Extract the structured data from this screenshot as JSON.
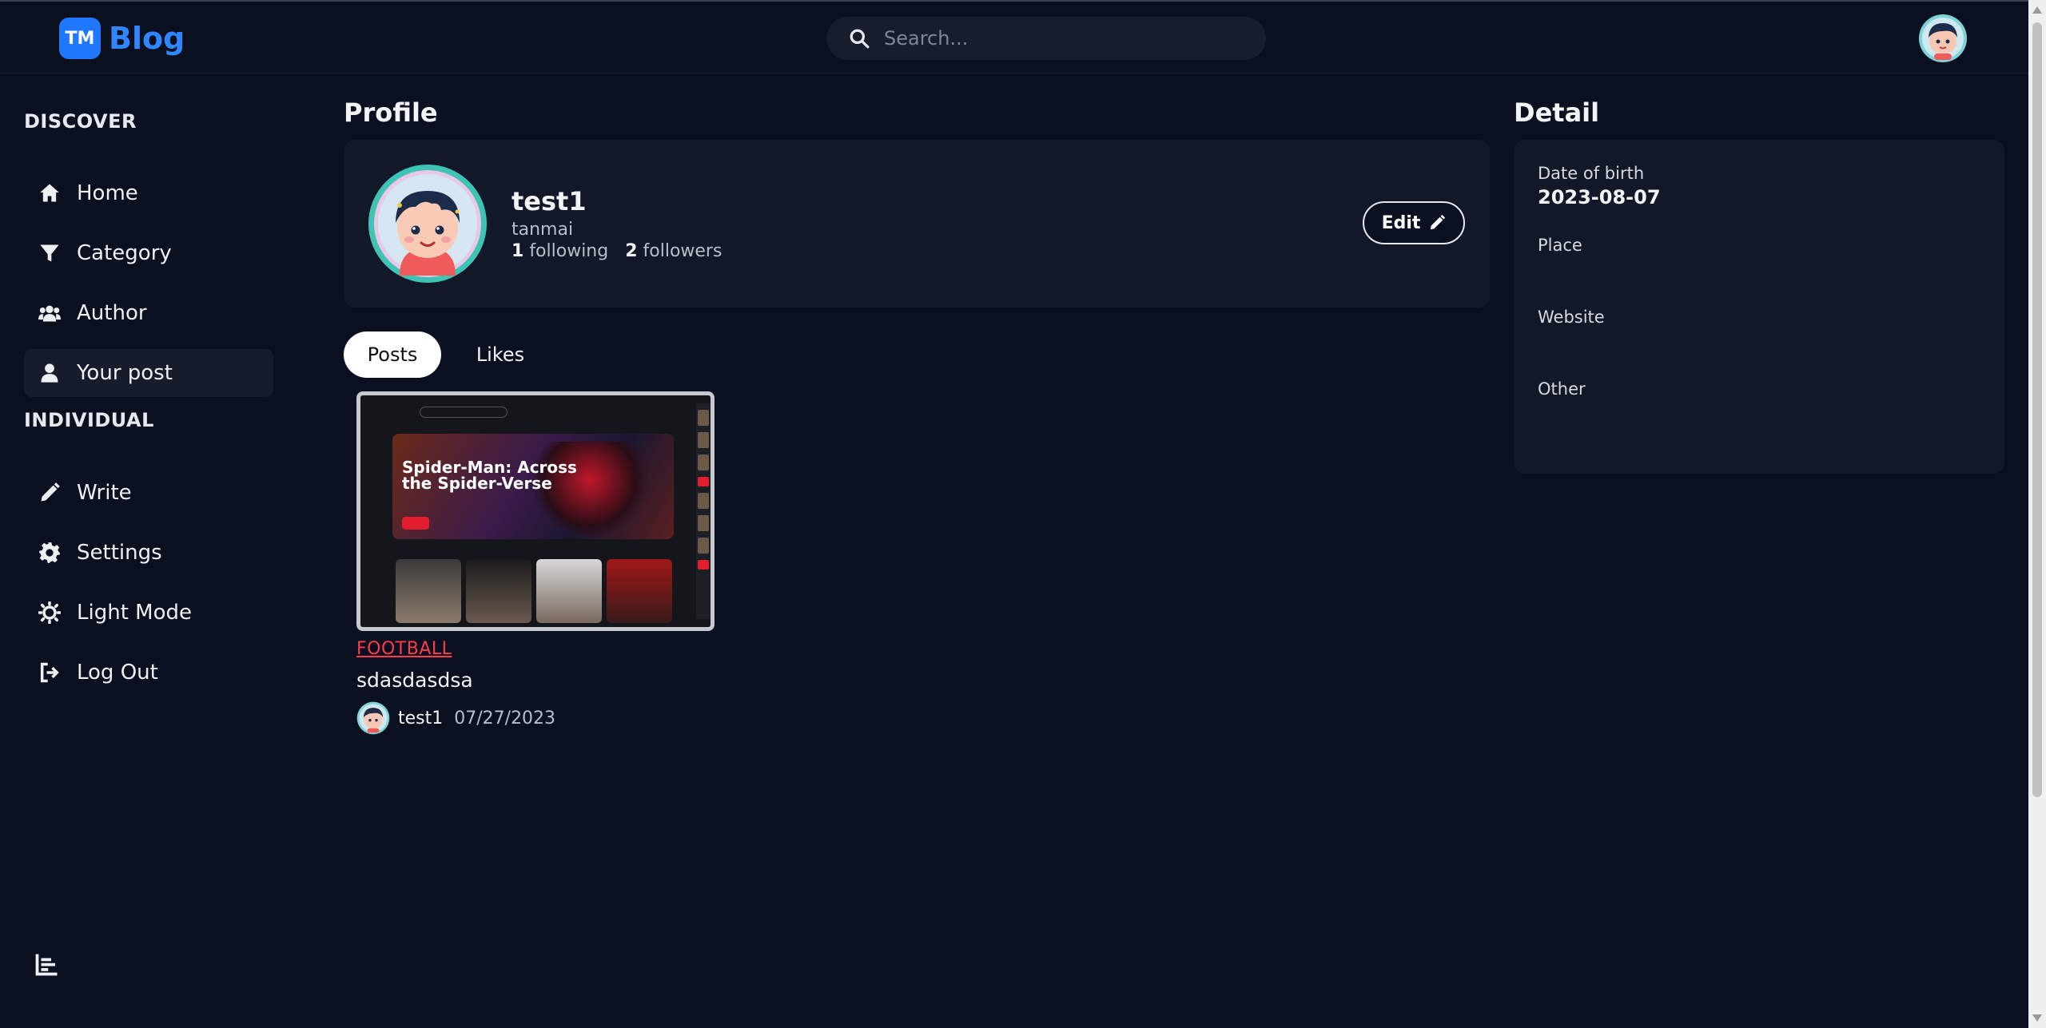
{
  "app": {
    "logo_badge": "TM",
    "logo_text": "Blog",
    "brand_color": "#1f78ff"
  },
  "search": {
    "placeholder": "Search..."
  },
  "sidebar": {
    "discover_heading": "DISCOVER",
    "discover_items": [
      {
        "label": "Home",
        "icon": "home-icon"
      },
      {
        "label": "Category",
        "icon": "filter-icon"
      },
      {
        "label": "Author",
        "icon": "users-icon"
      },
      {
        "label": "Your post",
        "icon": "user-icon",
        "active": true
      }
    ],
    "individual_heading": "INDIVIDUAL",
    "individual_items": [
      {
        "label": "Write",
        "icon": "pencil-icon"
      },
      {
        "label": "Settings",
        "icon": "gear-icon"
      },
      {
        "label": "Light Mode",
        "icon": "sun-icon"
      },
      {
        "label": "Log Out",
        "icon": "logout-icon"
      }
    ]
  },
  "profile": {
    "section_title": "Profile",
    "name": "test1",
    "handle": "tanmai",
    "following_count": "1",
    "following_label": "following",
    "followers_count": "2",
    "followers_label": "followers",
    "edit_label": "Edit"
  },
  "tabs": {
    "posts": "Posts",
    "likes": "Likes",
    "active": "Posts"
  },
  "posts": [
    {
      "thumbnail_title": "Spider-Man: Across the Spider-Verse",
      "category": "FOOTBALL",
      "title": "sdasdasdsa",
      "author": "test1",
      "date": "07/27/2023"
    }
  ],
  "detail": {
    "section_title": "Detail",
    "dob_label": "Date of birth",
    "dob_value": "2023-08-07",
    "place_label": "Place",
    "place_value": "",
    "website_label": "Website",
    "website_value": "",
    "other_label": "Other",
    "other_value": ""
  },
  "colors": {
    "background": "#0b1020",
    "card": "#121828",
    "accent_red": "#ff3b4b"
  }
}
